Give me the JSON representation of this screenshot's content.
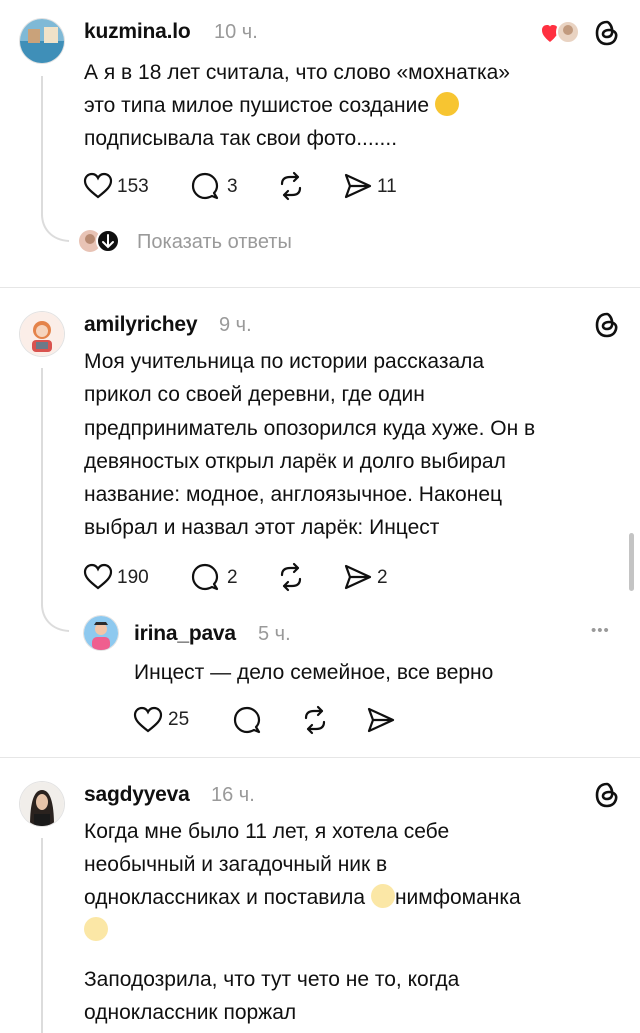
{
  "comments": [
    {
      "username": "kuzmina.lo",
      "time": "10 ч.",
      "lines": [
        "А я в 18 лет считала, что слово «мохнатка»",
        "это типа милое пушистое создание",
        "подписывала так свои фото......."
      ],
      "emoji_after_line_2": "rolling-laughing-emoji",
      "likes": "153",
      "replies": "3",
      "shares": "11",
      "show_replies": "Показать ответы"
    },
    {
      "username": "amilyrichey",
      "time": "9 ч.",
      "lines": [
        "Моя учительница по истории рассказала",
        "прикол со своей деревни, где один",
        "предприниматель опозорился куда хуже. Он в",
        "девяностых открыл ларёк и долго выбирал",
        "название: модное, англоязычное. Наконец",
        "выбрал и назвал этот ларёк: Инцест"
      ],
      "likes": "190",
      "replies": "2",
      "shares": "2",
      "reply": {
        "username": "irina_pava",
        "time": "5 ч.",
        "text": "Инцест — дело семейное, все верно",
        "likes": "25",
        "more": "•••"
      }
    },
    {
      "username": "sagdyyeva",
      "time": "16 ч.",
      "lines": [
        "Когда мне было 11 лет, я хотела себе",
        "необычный и загадочный ник в",
        "одноклассниках и поставила",
        "нимфоманка"
      ],
      "emoji_name": "dizzy-emoji",
      "lines2": [
        "Заподозрила, что тут чето не то, когда",
        "одноклассник поржал"
      ]
    }
  ],
  "colors": {
    "like_red": "#ff3040",
    "muted": "#9a9a9a",
    "text": "#101010"
  }
}
